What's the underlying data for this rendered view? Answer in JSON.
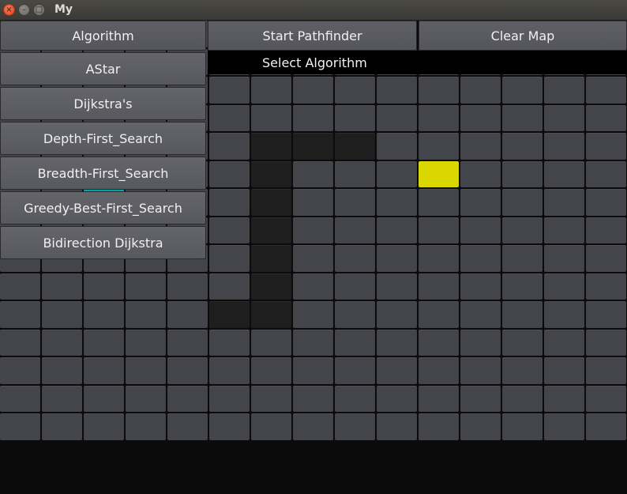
{
  "window": {
    "title": "My"
  },
  "window_controls": {
    "close": "×",
    "minimize": "–",
    "maximize": "□"
  },
  "toolbar": {
    "algorithm_label": "Algorithm",
    "start_label": "Start Pathfinder",
    "clear_label": "Clear Map"
  },
  "status": {
    "text": "Select Algorithm"
  },
  "algorithms": [
    {
      "label": "AStar"
    },
    {
      "label": "Dijkstra's"
    },
    {
      "label": "Depth-First_Search"
    },
    {
      "label": "Breadth-First_Search"
    },
    {
      "label": "Greedy-Best-First_Search"
    },
    {
      "label": "Bidirection Dijkstra"
    }
  ],
  "grid": {
    "cols": 15,
    "rows": 15,
    "walls": [
      [
        6,
        4
      ],
      [
        6,
        5
      ],
      [
        6,
        6
      ],
      [
        6,
        7
      ],
      [
        6,
        8
      ],
      [
        6,
        9
      ],
      [
        6,
        10
      ],
      [
        7,
        4
      ],
      [
        8,
        4
      ],
      [
        5,
        10
      ]
    ],
    "start": [
      2,
      6
    ],
    "end": [
      10,
      5
    ],
    "colors": {
      "empty": "#44444b",
      "wall": "#1e1e1e",
      "start": "#03a6a6",
      "end": "#d9d600"
    }
  }
}
